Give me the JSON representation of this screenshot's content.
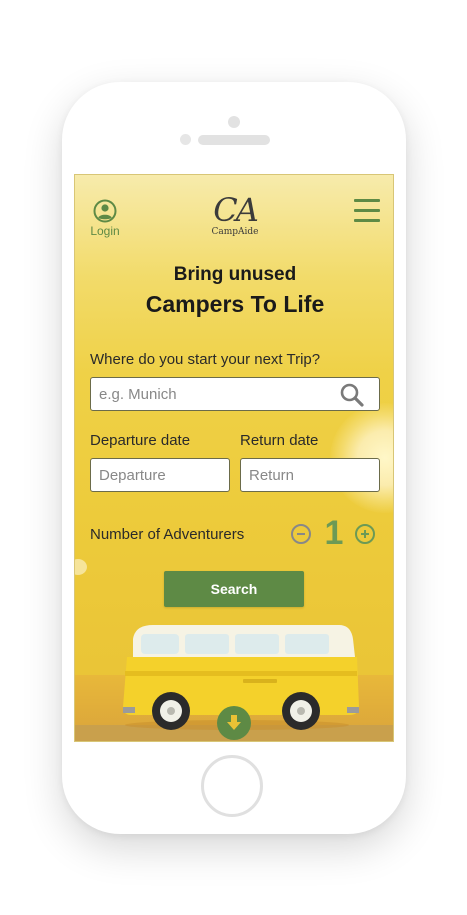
{
  "header": {
    "login_label": "Login",
    "logo_mark": "CA",
    "logo_name": "CampAide"
  },
  "hero": {
    "line1": "Bring unused",
    "line2": "Campers To Life"
  },
  "trip": {
    "start_label": "Where do you start your next Trip?",
    "start_placeholder": "e.g. Munich",
    "departure_label": "Departure date",
    "departure_placeholder": "Departure",
    "return_label": "Return date",
    "return_placeholder": "Return",
    "adventurers_label": "Number of Adventurers",
    "adventurers_count": "1",
    "search_label": "Search"
  },
  "colors": {
    "accent": "#5e8a45",
    "background": "#efd147"
  },
  "icons": {
    "login": "user-circle-icon",
    "menu": "hamburger-menu-icon",
    "search": "search-icon",
    "minus": "minus-circle-icon",
    "plus": "plus-circle-icon",
    "scroll": "arrow-down-icon"
  }
}
